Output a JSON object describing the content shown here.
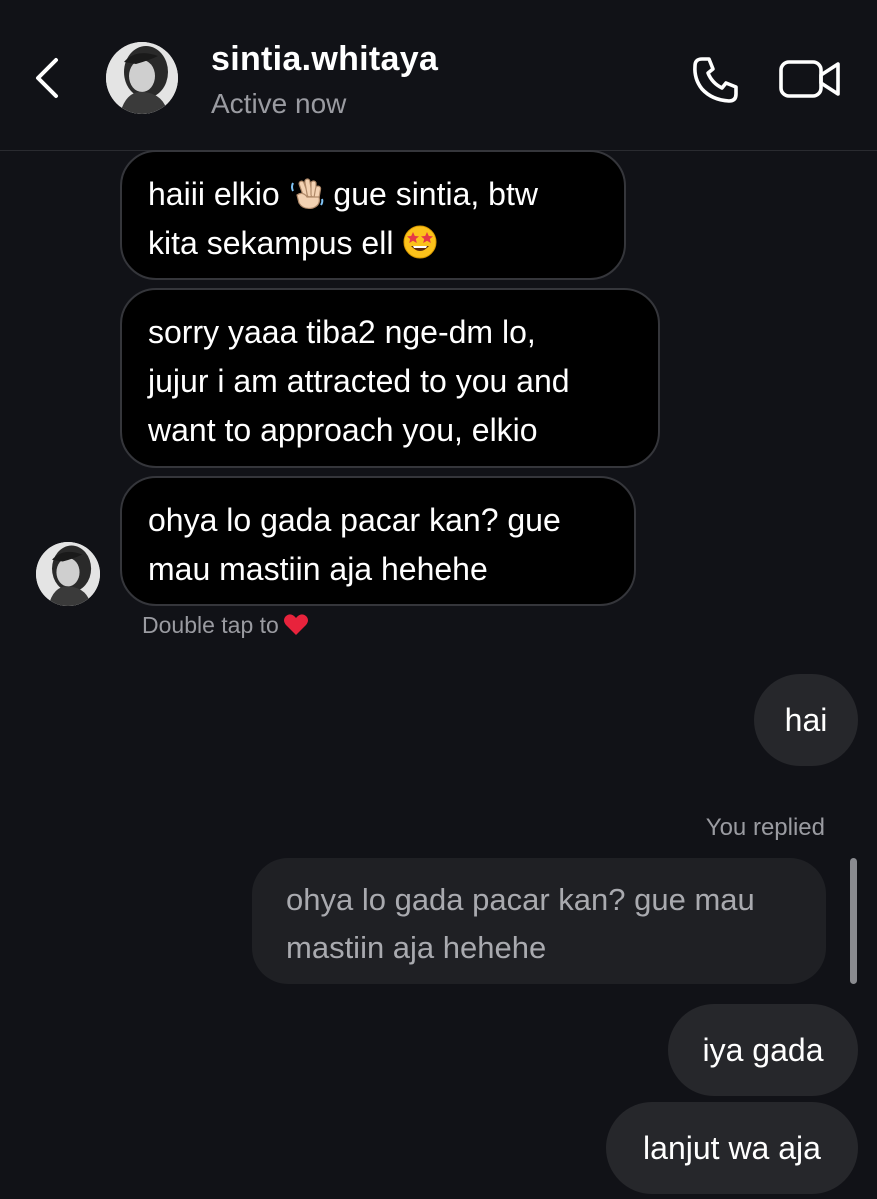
{
  "header": {
    "username": "sintia.whitaya",
    "status": "Active now",
    "icons": {
      "back": "chevron-left-icon",
      "call": "phone-icon",
      "video": "video-camera-icon"
    }
  },
  "messages": {
    "received": [
      {
        "text_before": "haiii elkio ",
        "emoji1": "👋",
        "text_middle": " gue sintia, btw\nkita sekampus ell ",
        "emoji2": "🤩"
      },
      {
        "text": "sorry yaaa tiba2 nge-dm lo,\njujur i am attracted to you and\nwant to approach you, elkio"
      },
      {
        "text": "ohya lo gada pacar kan? gue\nmau mastiin aja hehehe"
      }
    ],
    "hint": "Double tap to",
    "hint_icon": "heart-icon",
    "sent": [
      {
        "text": "hai"
      },
      {
        "reply_label": "You replied",
        "quoted": "ohya lo gada pacar kan? gue mau\nmastiin aja hehehe"
      },
      {
        "text": "iya gada"
      },
      {
        "text": "lanjut wa aja"
      }
    ]
  },
  "colors": {
    "background": "#111217",
    "incoming_bubble": "#000000",
    "incoming_border": "#35363b",
    "outgoing_bubble": "#26272b",
    "reply_bubble": "#1f2024",
    "muted_text": "#9a9ba1",
    "heart": "#e8233c"
  }
}
